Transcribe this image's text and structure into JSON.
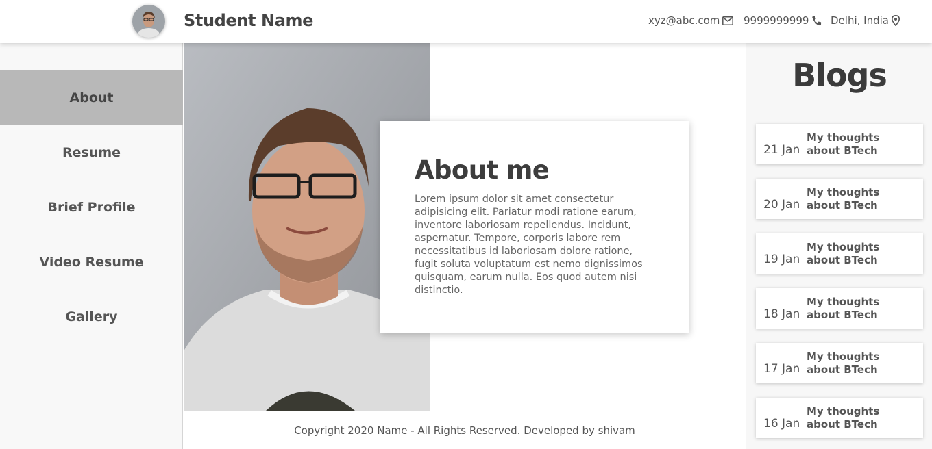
{
  "header": {
    "name": "Student Name",
    "email": "xyz@abc.com",
    "phone": "9999999999",
    "location": "Delhi, India"
  },
  "sidebar": {
    "items": [
      {
        "label": "About",
        "active": true
      },
      {
        "label": "Resume",
        "active": false
      },
      {
        "label": "Brief Profile",
        "active": false
      },
      {
        "label": "Video Resume",
        "active": false
      },
      {
        "label": "Gallery",
        "active": false
      }
    ]
  },
  "about": {
    "title": "About me",
    "text": "Lorem ipsum dolor sit amet consectetur adipisicing elit. Pariatur modi ratione earum, inventore laboriosam repellendus. Incidunt, aspernatur. Tempore, corporis labore rem necessitatibus id laboriosam dolore ratione, fugit soluta voluptatum est nemo dignissimos quisquam, earum nulla. Eos quod autem nisi distinctio."
  },
  "footer": {
    "text": "Copyright 2020 Name - All Rights Reserved. Developed by shivam"
  },
  "blogs": {
    "title": "Blogs",
    "items": [
      {
        "date": "21 Jan",
        "title": "My thoughts about BTech"
      },
      {
        "date": "20 Jan",
        "title": "My thoughts about BTech"
      },
      {
        "date": "19 Jan",
        "title": "My thoughts about BTech"
      },
      {
        "date": "18 Jan",
        "title": "My thoughts about BTech"
      },
      {
        "date": "17 Jan",
        "title": "My thoughts about BTech"
      },
      {
        "date": "16 Jan",
        "title": "My thoughts about BTech"
      }
    ]
  },
  "icons": {
    "email": "envelope-icon",
    "phone": "phone-icon",
    "location": "map-marker-icon"
  },
  "colors": {
    "active_nav": "#b8b8b8",
    "sidebar_bg": "#f8f8f8",
    "text": "#444444"
  }
}
